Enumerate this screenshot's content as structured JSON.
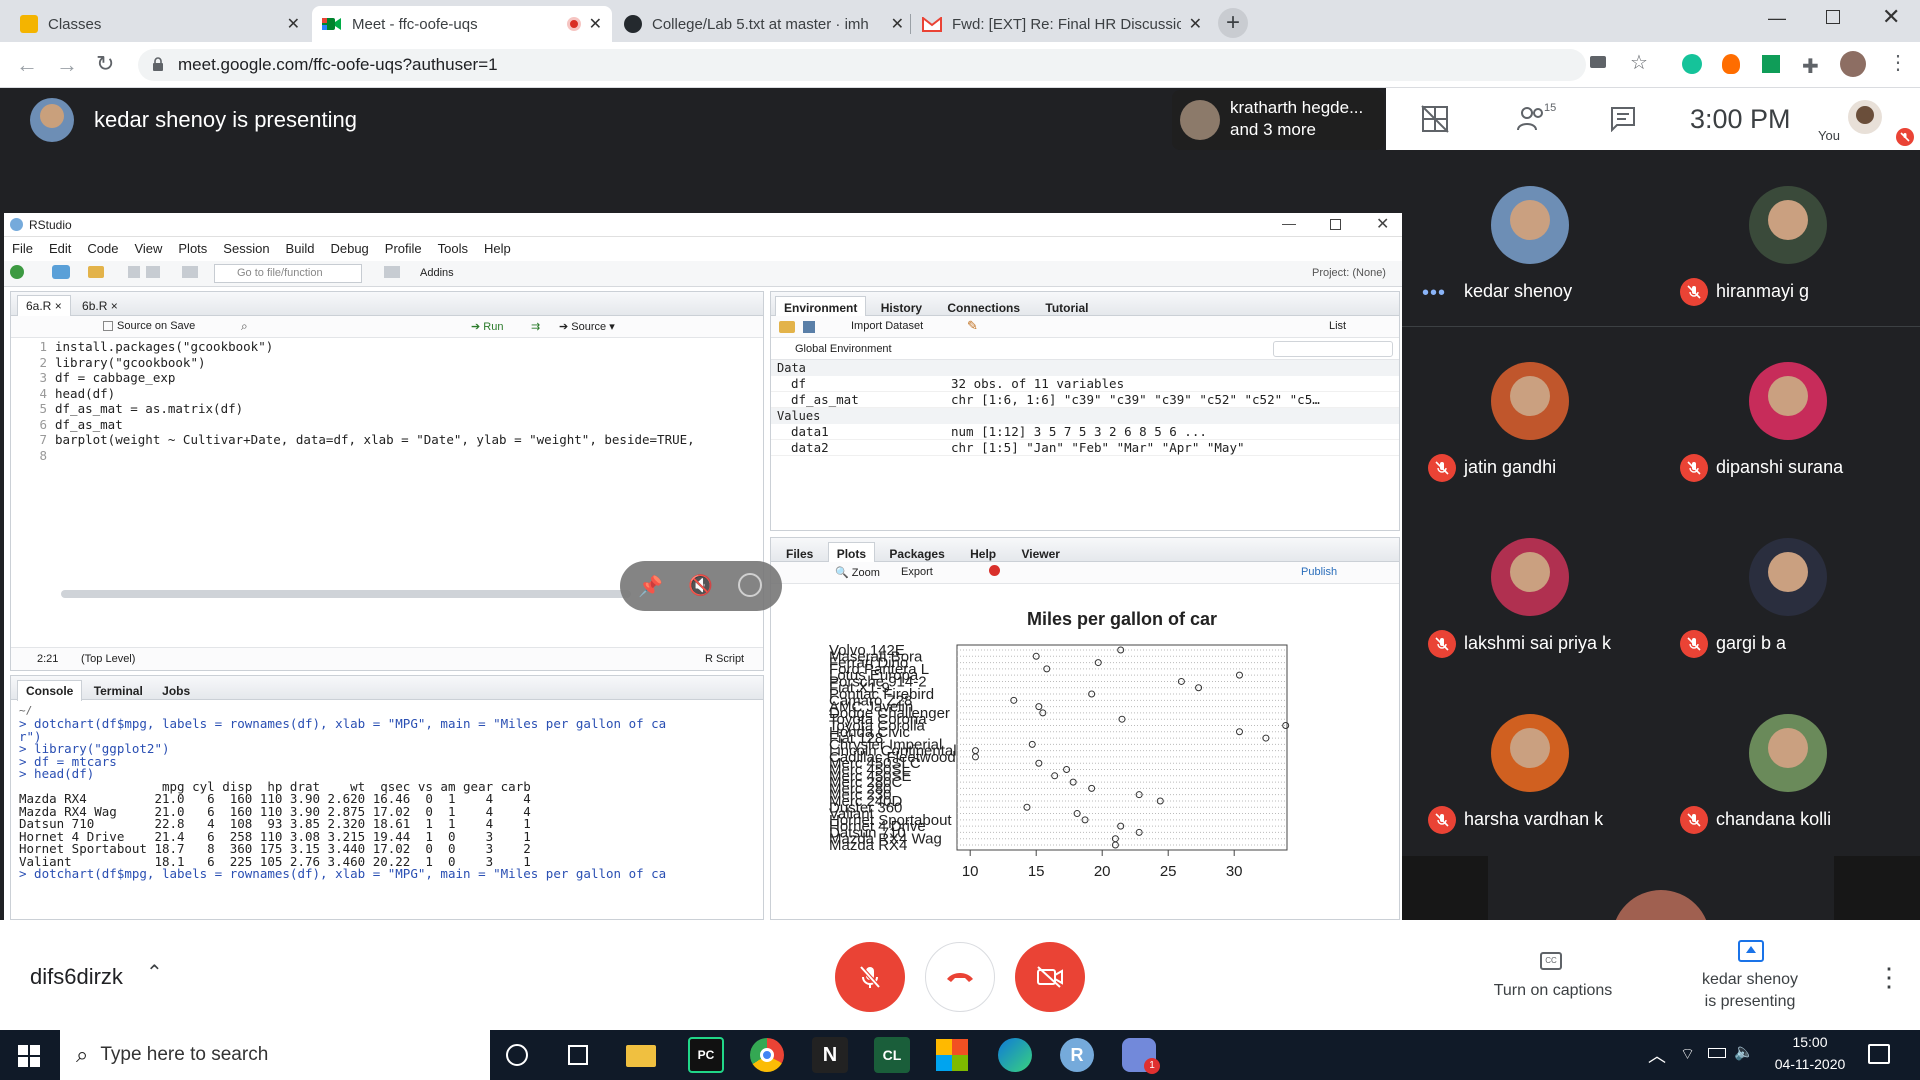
{
  "browser": {
    "tabs": [
      {
        "title": "Classes",
        "icon": "classroom-icon"
      },
      {
        "title": "Meet - ffc-oofe-uqs",
        "icon": "meet-icon",
        "active": true
      },
      {
        "title": "College/Lab 5.txt at master · imh",
        "icon": "github-icon"
      },
      {
        "title": "Fwd: [EXT] Re: Final HR Discussio",
        "icon": "gmail-icon"
      }
    ],
    "url": "meet.google.com/ffc-oofe-uqs?authuser=1"
  },
  "meet": {
    "presenting_banner": "kedar shenoy is presenting",
    "presenter_chip": {
      "line1": "kratharth hegde...",
      "line2": "and 3 more"
    },
    "people_count": "15",
    "time": "3:00 PM",
    "you_label": "You",
    "meeting_code": "difs6dirzk",
    "captions_label": "Turn on captions",
    "presenting_label_line1": "kedar shenoy",
    "presenting_label_line2": "is presenting",
    "participants": [
      {
        "name": "kedar shenoy",
        "speaking": true,
        "color": "#6d8eb5"
      },
      {
        "name": "hiranmayi g",
        "color": "#3a4a3a"
      },
      {
        "name": "jatin gandhi",
        "color": "#c0562c"
      },
      {
        "name": "dipanshi surana",
        "color": "#c72c5a"
      },
      {
        "name": "lakshmi sai priya k",
        "color": "#b03050"
      },
      {
        "name": "gargi b a",
        "color": "#2a2e3e"
      },
      {
        "name": "harsha vardhan k",
        "color": "#d06020"
      },
      {
        "name": "chandana kolli",
        "color": "#6a8a5a"
      }
    ],
    "colors": {
      "mic_off": "#ea4335",
      "bg": "#202124",
      "accent": "#1a73e8"
    }
  },
  "rstudio": {
    "title": "RStudio",
    "menu": [
      "File",
      "Edit",
      "Code",
      "View",
      "Plots",
      "Session",
      "Build",
      "Debug",
      "Profile",
      "Tools",
      "Help"
    ],
    "goto_placeholder": "Go to file/function",
    "addins": "Addins",
    "project": "Project: (None)",
    "editor_tabs": [
      "6a.R",
      "6b.R"
    ],
    "source_on_save": "Source on Save",
    "run": "Run",
    "source": "Source",
    "code_lines": [
      "install.packages(\"gcookbook\")",
      "library(\"gcookbook\")",
      "df = cabbage_exp",
      "head(df)",
      "df_as_mat = as.matrix(df)",
      "df_as_mat",
      "barplot(weight ~ Cultivar+Date, data=df, xlab = \"Date\", ylab = \"weight\", beside=TRUE,",
      ""
    ],
    "status_pos": "2:21",
    "status_level": "(Top Level)",
    "status_type": "R Script",
    "console_tabs": [
      "Console",
      "Terminal",
      "Jobs"
    ],
    "console_path": "~/",
    "console_lines": [
      "> dotchart(df$mpg, labels = rownames(df), xlab = \"MPG\", main = \"Miles per gallon of ca",
      "r\")",
      "> library(\"ggplot2\")",
      "> df = mtcars",
      "> head(df)",
      "                   mpg cyl disp  hp drat    wt  qsec vs am gear carb",
      "Mazda RX4         21.0   6  160 110 3.90 2.620 16.46  0  1    4    4",
      "Mazda RX4 Wag     21.0   6  160 110 3.90 2.875 17.02  0  1    4    4",
      "Datsun 710        22.8   4  108  93 3.85 2.320 18.61  1  1    4    1",
      "Hornet 4 Drive    21.4   6  258 110 3.08 3.215 19.44  1  0    3    1",
      "Hornet Sportabout 18.7   8  360 175 3.15 3.440 17.02  0  0    3    2",
      "Valiant           18.1   6  225 105 2.76 3.460 20.22  1  0    3    1",
      "> dotchart(df$mpg, labels = rownames(df), xlab = \"MPG\", main = \"Miles per gallon of ca"
    ],
    "env_tabs": [
      "Environment",
      "History",
      "Connections",
      "Tutorial"
    ],
    "import_dataset": "Import Dataset",
    "list_label": "List",
    "global_env": "Global Environment",
    "env_sections": {
      "data": "Data",
      "values": "Values"
    },
    "env_rows": [
      {
        "name": "df",
        "value": "32 obs. of 11 variables"
      },
      {
        "name": "df_as_mat",
        "value": "chr [1:6, 1:6] \"c39\" \"c39\" \"c39\" \"c52\" \"c52\" \"c5…"
      },
      {
        "name": "data1",
        "value": "num [1:12] 3 5 7 5 3 2 6 8 5 6 ..."
      },
      {
        "name": "data2",
        "value": "chr [1:5] \"Jan\" \"Feb\" \"Mar\" \"Apr\" \"May\""
      }
    ],
    "files_tabs": [
      "Files",
      "Plots",
      "Packages",
      "Help",
      "Viewer"
    ],
    "zoom": "Zoom",
    "export": "Export",
    "publish": "Publish"
  },
  "chart_data": {
    "type": "scatter",
    "title": "Miles per gallon of car",
    "xlim": [
      9,
      34
    ],
    "xticks": [
      "10",
      "15",
      "20",
      "25",
      "30"
    ],
    "grid": true,
    "labels": [
      "Mazda RX4",
      "Mazda RX4 Wag",
      "Datsun 710",
      "Hornet 4 Drive",
      "Hornet Sportabout",
      "Valiant",
      "Duster 360",
      "Merc 240D",
      "Merc 230",
      "Merc 280",
      "Merc 280C",
      "Merc 450SE",
      "Merc 450SL",
      "Merc 450SLC",
      "Cadillac Fleetwood",
      "Lincoln Continental",
      "Chrysler Imperial",
      "Fiat 128",
      "Honda Civic",
      "Toyota Corolla",
      "Toyota Corona",
      "Dodge Challenger",
      "AMC Javelin",
      "Camaro Z28",
      "Pontiac Firebird",
      "Fiat X1-9",
      "Porsche 914-2",
      "Lotus Europa",
      "Ford Pantera L",
      "Ferrari Dino",
      "Maserati Bora",
      "Volvo 142E"
    ],
    "values": [
      21.0,
      21.0,
      22.8,
      21.4,
      18.7,
      18.1,
      14.3,
      24.4,
      22.8,
      19.2,
      17.8,
      16.4,
      17.3,
      15.2,
      10.4,
      10.4,
      14.7,
      32.4,
      30.4,
      33.9,
      21.5,
      15.5,
      15.2,
      13.3,
      19.2,
      27.3,
      26.0,
      30.4,
      15.8,
      19.7,
      15.0,
      21.4
    ]
  },
  "taskbar": {
    "search_placeholder": "Type here to search",
    "time": "15:00",
    "date": "04-11-2020",
    "apps": [
      "cortana-icon",
      "task-view-icon",
      "file-explorer-icon",
      "pycharm-icon",
      "chrome-icon",
      "notion-icon",
      "cl-icon",
      "office-icon",
      "edge-icon",
      "r-icon",
      "discord-icon"
    ]
  }
}
